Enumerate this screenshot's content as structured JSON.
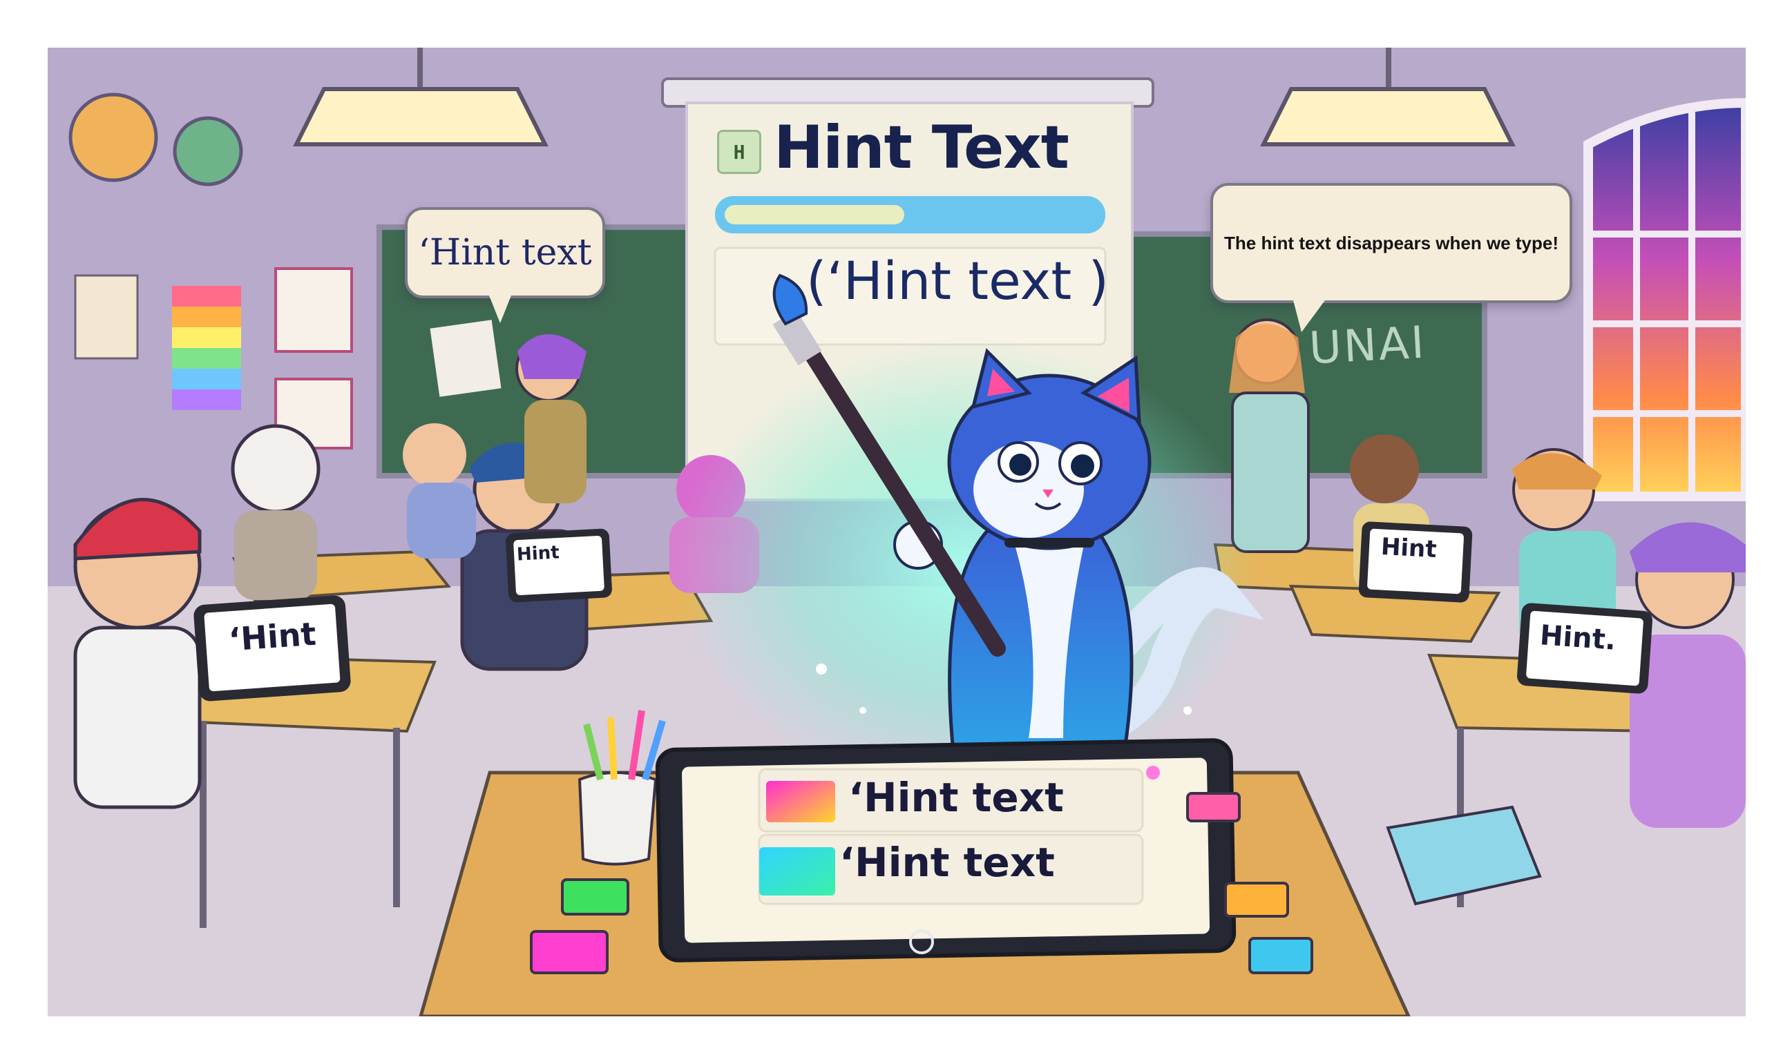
{
  "board": {
    "title": "Hint Text",
    "subtitle": "(‘Hint text )",
    "icon_letter": "H",
    "chalk_text": "UNAI"
  },
  "speech_left": {
    "text": "‘Hint text"
  },
  "speech_right": {
    "text": "The hint text disappears when we type!"
  },
  "tablets": {
    "student_front_left": "‘Hint",
    "student_center": "Hint",
    "student_right_back": "Hint",
    "student_right_front": "Hint."
  },
  "main_tablet": {
    "rows": [
      {
        "text": "‘Hint text",
        "swatch": "#ff3cc4"
      },
      {
        "text": "‘Hint text",
        "swatch": "#27c9e6"
      }
    ]
  },
  "colors": {
    "cat_blue": "#2f5fd0",
    "glow": "#7df0d6",
    "chalkboard": "#3f6a52",
    "desk": "#e6b55c",
    "board_bg": "#f3efe0"
  }
}
